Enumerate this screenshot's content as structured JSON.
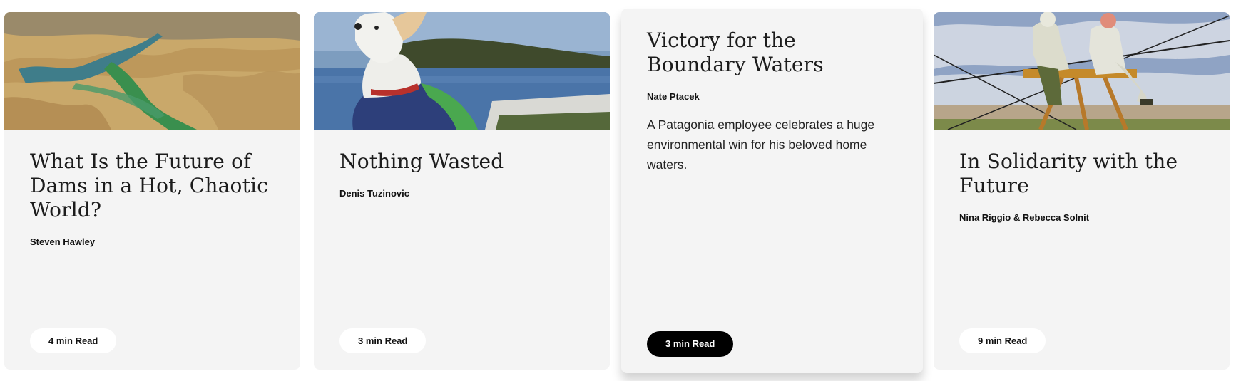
{
  "cards": [
    {
      "title": "What Is the Future of Dams in a Hot, Chaotic World?",
      "author": "Steven Hawley",
      "read_time": "4 min Read",
      "image": "aerial-reservoir-hills-image"
    },
    {
      "title": "Nothing Wasted",
      "author": "Denis Tuzinovic",
      "read_time": "3 min Read",
      "image": "dog-in-jacket-on-boat-image"
    },
    {
      "title": "Victory for the Boundary Waters",
      "author": "Nate Ptacek",
      "description": "A Patagonia employee celebrates a huge environmental win for his beloved home waters.",
      "read_time": "3 min Read"
    },
    {
      "title": "In Solidarity with the Future",
      "author": "Nina Riggio & Rebecca Solnit",
      "read_time": "9 min Read",
      "image": "workers-on-power-line-image"
    }
  ]
}
